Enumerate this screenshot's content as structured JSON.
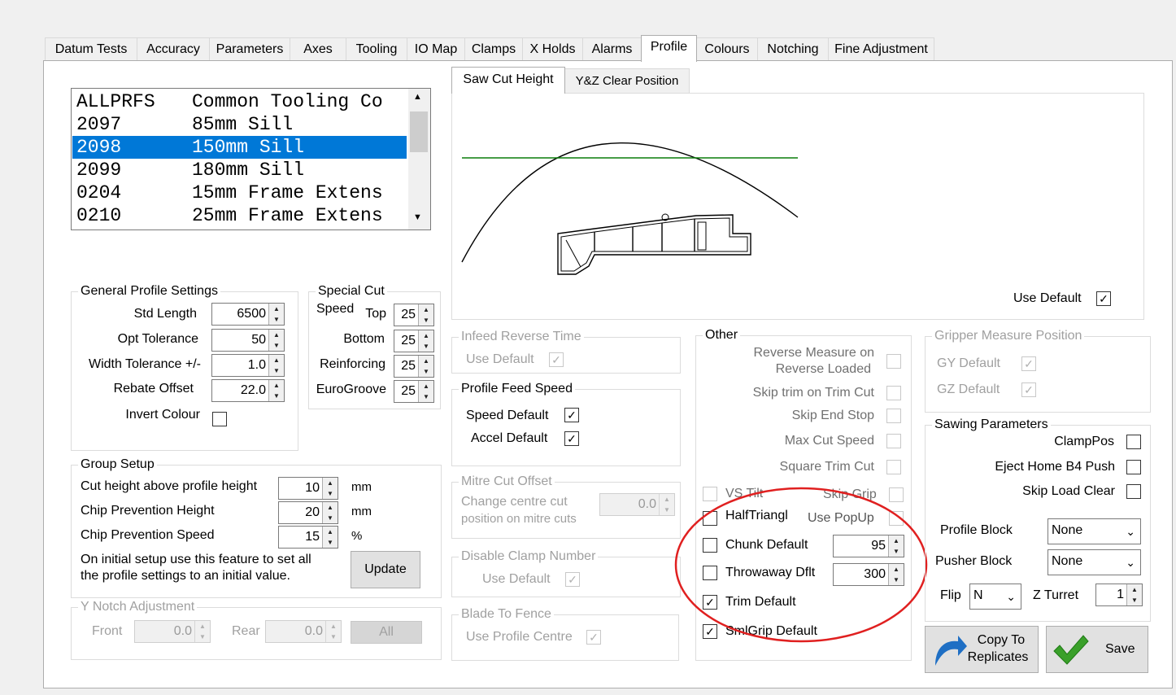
{
  "tabs": [
    "Datum Tests",
    "Accuracy",
    "Parameters",
    "Axes",
    "Tooling",
    "IO Map",
    "Clamps",
    "X Holds",
    "Alarms",
    "Profile",
    "Colours",
    "Notching",
    "Fine Adjustment"
  ],
  "active_tab": "Profile",
  "profile_list": {
    "items": [
      {
        "code": "ALLPRFS",
        "desc": "Common Tooling Co"
      },
      {
        "code": "2097",
        "desc": "85mm Sill"
      },
      {
        "code": "2098",
        "desc": "150mm Sill"
      },
      {
        "code": "2099",
        "desc": "180mm Sill"
      },
      {
        "code": "0204",
        "desc": "15mm Frame Extens"
      },
      {
        "code": "0210",
        "desc": "25mm Frame Extens"
      }
    ],
    "selected_index": 2
  },
  "general": {
    "title": "General Profile Settings",
    "std_length_label": "Std Length",
    "std_length": "6500",
    "opt_tolerance_label": "Opt Tolerance",
    "opt_tolerance": "50",
    "width_tolerance_label": "Width Tolerance +/-",
    "width_tolerance": "1.0",
    "rebate_offset_label": "Rebate Offset",
    "rebate_offset": "22.0",
    "invert_colour_label": "Invert Colour"
  },
  "special_cut": {
    "title": "Special Cut",
    "speed_label": "Speed",
    "top_label": "Top",
    "top": "25",
    "bottom_label": "Bottom",
    "bottom": "25",
    "reinforcing_label": "Reinforcing",
    "reinforcing": "25",
    "eurogroove_label": "EuroGroove",
    "eurogroove": "25"
  },
  "group_setup": {
    "title": "Group Setup",
    "cut_height_label": "Cut height above profile height",
    "cut_height": "10",
    "cut_height_unit": "mm",
    "chip_height_label": "Chip Prevention Height",
    "chip_height": "20",
    "chip_height_unit": "mm",
    "chip_speed_label": "Chip Prevention Speed",
    "chip_speed": "15",
    "chip_speed_unit": "%",
    "note_line1": "On initial setup use this feature to set all",
    "note_line2": "the profile settings to an initial value.",
    "update_label": "Update"
  },
  "y_notch": {
    "title": "Y Notch Adjustment",
    "front_label": "Front",
    "front": "0.0",
    "rear_label": "Rear",
    "rear": "0.0",
    "all_label": "All"
  },
  "subtabs": [
    "Saw Cut Height",
    "Y&Z Clear Position"
  ],
  "graphic": {
    "use_default_label": "Use Default",
    "use_default": true
  },
  "infeed": {
    "title": "Infeed Reverse Time",
    "use_default_label": "Use Default"
  },
  "feed_speed": {
    "title": "Profile Feed Speed",
    "speed_default_label": "Speed Default",
    "accel_default_label": "Accel Default"
  },
  "mitre": {
    "title": "Mitre Cut Offset",
    "line1": "Change centre cut",
    "line2": "position on mitre cuts",
    "value": "0.0"
  },
  "disable_clamp": {
    "title": "Disable Clamp Number",
    "use_default_label": "Use Default"
  },
  "blade_fence": {
    "title": "Blade To Fence",
    "use_profile_centre_label": "Use Profile Centre"
  },
  "other": {
    "title": "Other",
    "reverse_measure_line1": "Reverse Measure on",
    "reverse_measure_line2": "Reverse Loaded",
    "skip_trim_label": "Skip trim on Trim Cut",
    "skip_end_stop_label": "Skip End Stop",
    "max_cut_speed_label": "Max Cut Speed",
    "square_trim_label": "Square Trim Cut",
    "vs_tilt_label": "VS Tilt",
    "skip_grip_label": "Skip Grip",
    "half_triangl_label": "HalfTriangl",
    "use_popup_label": "Use PopUp",
    "chunk_default_label": "Chunk Default",
    "chunk_default": "95",
    "throwaway_label": "Throwaway Dflt",
    "throwaway": "300",
    "trim_default_label": "Trim Default",
    "smlgrip_label": "SmlGrip Default"
  },
  "gripper": {
    "title": "Gripper Measure Position",
    "gy_label": "GY  Default",
    "gz_label": "GZ  Default"
  },
  "sawing": {
    "title": "Sawing Parameters",
    "clamp_pos_label": "ClampPos",
    "eject_label": "Eject Home B4 Push",
    "skip_load_label": "Skip Load Clear",
    "profile_block_label": "Profile Block",
    "profile_block": "None",
    "pusher_block_label": "Pusher Block",
    "pusher_block": "None",
    "flip_label": "Flip",
    "flip": "N",
    "z_turret_label": "Z Turret",
    "z_turret": "1"
  },
  "buttons": {
    "copy_line1": "Copy To",
    "copy_line2": "Replicates",
    "save": "Save"
  },
  "colors": {
    "selection": "#0078d7",
    "highlight_circle": "#e02020",
    "cut_line": "#0a7d0a",
    "save_check": "#3aa02a",
    "copy_arrow": "#1f6fc4"
  }
}
